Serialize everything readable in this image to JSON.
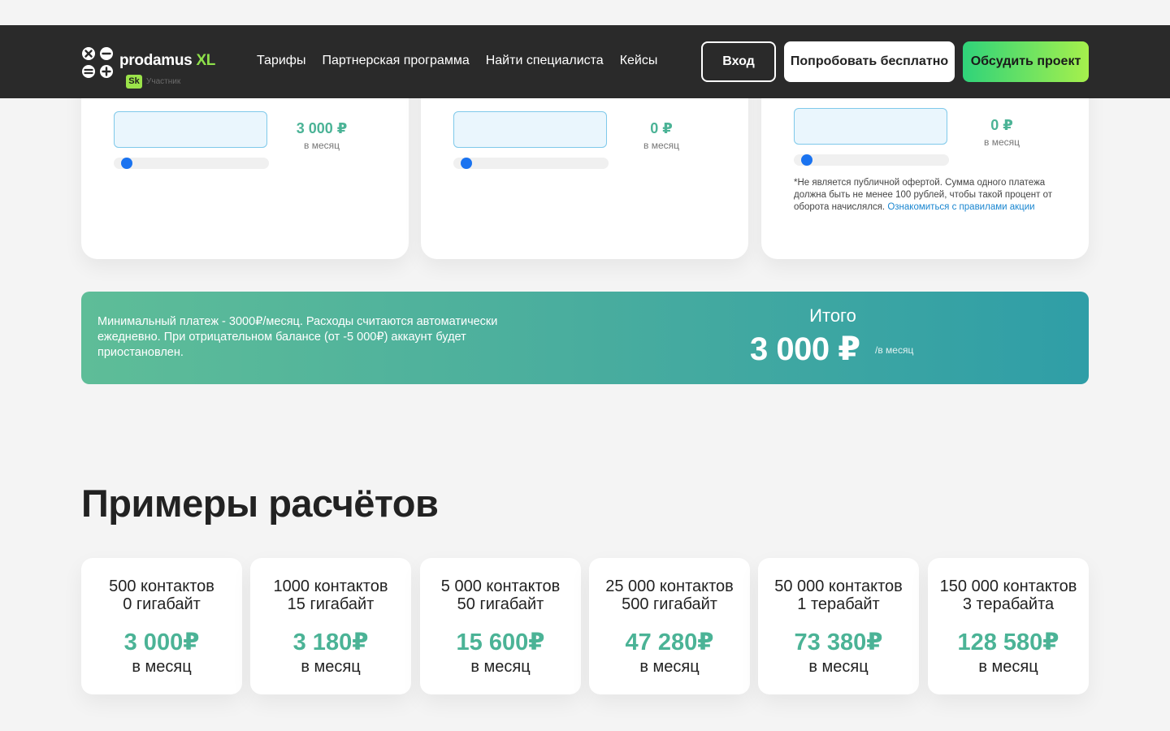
{
  "header": {
    "logo_text": "prodamus",
    "logo_suffix": "XL",
    "badge_text": "Sk",
    "badge_label": "Участник",
    "nav": [
      "Тарифы",
      "Партнерская программа",
      "Найти специалиста",
      "Кейсы"
    ],
    "login": "Вход",
    "try_free": "Попробовать бесплатно",
    "discuss": "Обсудить проект",
    "colors": {
      "header_bg": "#2a2a2a",
      "accent_green": "#8ee04a",
      "cta_gradient_start": "#2fd37a",
      "cta_gradient_end": "#a6f04c"
    }
  },
  "calculators": [
    {
      "price": "3 000 ₽",
      "unit": "в месяц",
      "slider_value": 0
    },
    {
      "price": "0 ₽",
      "unit": "в месяц",
      "slider_value": 0
    },
    {
      "price": "0 ₽",
      "unit": "в месяц",
      "slider_value": 0,
      "note": "*Не является публичной офертой. Сумма одного платежа должна быть не менее 100 рублей, чтобы такой процент от оборота начислялся.",
      "note_link": "Ознакомиться с правилами акции"
    }
  ],
  "total": {
    "description": "Минимальный платеж - 3000₽/месяц. Расходы считаются автоматически ежедневно. При отрицательном балансе (от -5 000₽) аккаунт будет приостановлен.",
    "label": "Итого",
    "amount": "3 000 ₽",
    "unit": "/в месяц"
  },
  "examples": {
    "title": "Примеры расчётов",
    "items": [
      {
        "contacts": "500 контактов",
        "storage": "0 гигабайт",
        "price": "3 000₽",
        "unit": "в месяц"
      },
      {
        "contacts": "1000 контактов",
        "storage": "15 гигабайт",
        "price": "3 180₽",
        "unit": "в месяц"
      },
      {
        "contacts": "5 000 контактов",
        "storage": "50 гигабайт",
        "price": "15 600₽",
        "unit": "в месяц"
      },
      {
        "contacts": "25 000 контактов",
        "storage": "500 гигабайт",
        "price": "47 280₽",
        "unit": "в месяц"
      },
      {
        "contacts": "50 000 контактов",
        "storage": "1 терабайт",
        "price": "73 380₽",
        "unit": "в месяц"
      },
      {
        "contacts": "150 000 контактов",
        "storage": "3 терабайта",
        "price": "128 580₽",
        "unit": "в месяц"
      }
    ]
  }
}
